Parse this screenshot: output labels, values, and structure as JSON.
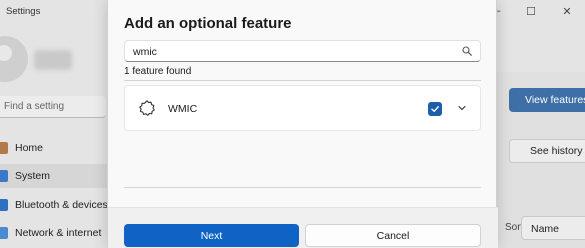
{
  "background": {
    "window_title": "Settings",
    "search_placeholder": "Find a setting",
    "nav": [
      {
        "label": "Home",
        "icon": "home-icon"
      },
      {
        "label": "System",
        "icon": "system-icon"
      },
      {
        "label": "Bluetooth & devices",
        "icon": "bluetooth-icon"
      },
      {
        "label": "Network & internet",
        "icon": "network-icon"
      }
    ],
    "view_features_label": "View features",
    "see_history_label": "See history",
    "sort_label": "Sort by:",
    "sort_value": "Name"
  },
  "dialog": {
    "title": "Add an optional feature",
    "search_value": "wmic",
    "found_text": "1 feature found",
    "features": [
      {
        "name": "WMIC",
        "checked": true,
        "icon": "gear-puzzle-icon"
      }
    ],
    "next_label": "Next",
    "cancel_label": "Cancel"
  },
  "colors": {
    "accent": "#0f63c4",
    "checkbox": "#1f5fa8"
  }
}
